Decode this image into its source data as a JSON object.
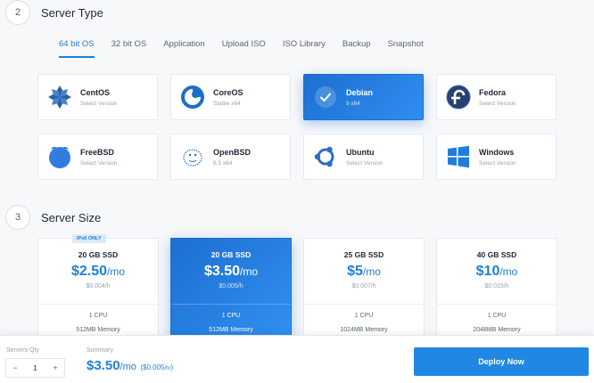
{
  "server_type": {
    "step": "2",
    "title": "Server Type",
    "tabs": [
      "64 bit OS",
      "32 bit OS",
      "Application",
      "Upload ISO",
      "ISO Library",
      "Backup",
      "Snapshot"
    ],
    "os": [
      {
        "name": "CentOS",
        "sub": "Select Version",
        "icon": "centos-icon"
      },
      {
        "name": "CoreOS",
        "sub": "Stable  x64",
        "icon": "coreos-icon"
      },
      {
        "name": "Debian",
        "sub": "9  x64",
        "icon": "check-icon",
        "selected": true
      },
      {
        "name": "Fedora",
        "sub": "Select Version",
        "icon": "fedora-icon"
      },
      {
        "name": "FreeBSD",
        "sub": "Select Version",
        "icon": "freebsd-icon"
      },
      {
        "name": "OpenBSD",
        "sub": "6.3  x64",
        "icon": "openbsd-icon"
      },
      {
        "name": "Ubuntu",
        "sub": "Select Version",
        "icon": "ubuntu-icon"
      },
      {
        "name": "Windows",
        "sub": "Select Version",
        "icon": "windows-icon"
      }
    ]
  },
  "server_size": {
    "step": "3",
    "title": "Server Size",
    "plans": [
      {
        "badge": "IPv6 ONLY",
        "storage": "20 GB SSD",
        "price": "$2.50",
        "per": "/mo",
        "hourly": "$0.004/h",
        "cpu": "1 CPU",
        "memory": "512MB Memory"
      },
      {
        "storage": "20 GB SSD",
        "price": "$3.50",
        "per": "/mo",
        "hourly": "$0.005/h",
        "cpu": "1 CPU",
        "memory": "512MB Memory",
        "selected": true
      },
      {
        "storage": "25 GB SSD",
        "price": "$5",
        "per": "/mo",
        "hourly": "$0.007/h",
        "cpu": "1 CPU",
        "memory": "1024MB Memory"
      },
      {
        "storage": "40 GB SSD",
        "price": "$10",
        "per": "/mo",
        "hourly": "$0.015/h",
        "cpu": "1 CPU",
        "memory": "2048MB Memory"
      }
    ]
  },
  "footer": {
    "qty_label": "Servers Qty",
    "qty_minus": "−",
    "qty_value": "1",
    "qty_plus": "+",
    "summary_label": "Summary",
    "summary_price": "$3.50",
    "summary_per": "/mo",
    "summary_hourly": "($0.005",
    "summary_hourly_unit": "/hr",
    "summary_close": ")",
    "deploy_label": "Deploy Now"
  },
  "colors": {
    "accent": "#1e7fd9",
    "selected_start": "#1d6fd1",
    "selected_end": "#2f8ef0"
  }
}
